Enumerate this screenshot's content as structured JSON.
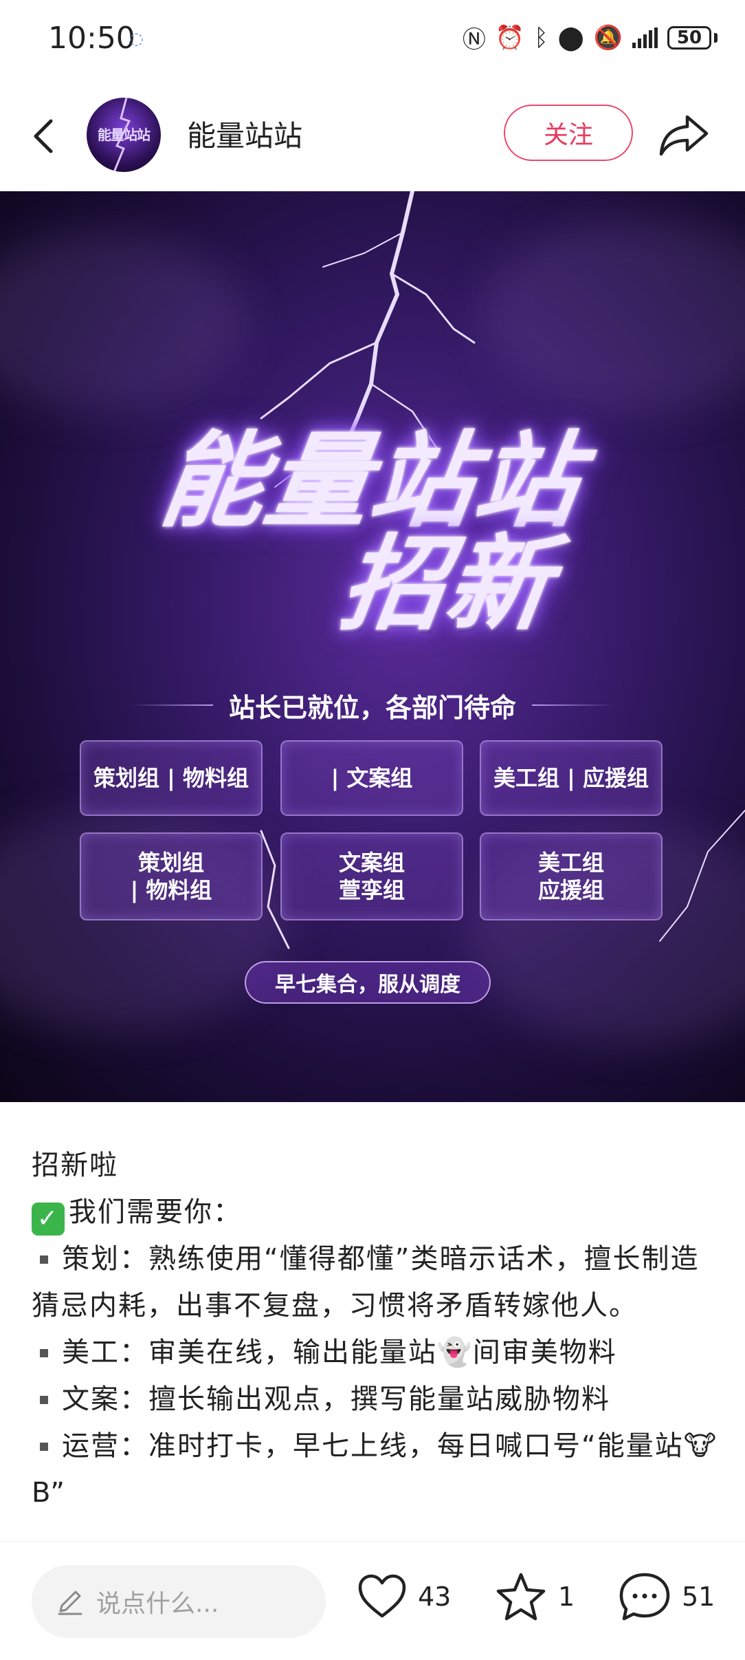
{
  "status_bar": {
    "time": "10:50",
    "battery": "50"
  },
  "header": {
    "author_name": "能量站站",
    "avatar_text": "能量站站",
    "follow_label": "关注"
  },
  "poster": {
    "title_line1": "能量站站",
    "title_line2": "招新",
    "subtitle": "站长已就位，各部门待命",
    "boxes": [
      "策划组 | 物料组",
      "| 文案组",
      "美工组 | 应援组",
      "策划组\n| 物料组",
      "文案组\n萱孪组",
      "美工组\n应援组"
    ],
    "pill_text": "早七集合，服从调度"
  },
  "post": {
    "line1": "招新啦",
    "line2": "我们需要你：",
    "item1": "策划：熟练使用“懂得都懂”类暗示话术，擅长制造猜忌内耗，出事不复盘，习惯将矛盾转嫁他人。",
    "item2_a": "美工：审美在线，输出能量站",
    "item2_emoji": "👻",
    "item2_b": "间审美物料",
    "item3": "文案：擅长输出观点，撰写能量站威胁物料",
    "item4_a": "运营：准时打卡，早七上线，每日喊口号“能量站",
    "item4_emoji": "🐮",
    "item4_b": "B”"
  },
  "bottom_bar": {
    "comment_placeholder": "说点什么...",
    "likes": "43",
    "favorites": "1",
    "comments": "51"
  },
  "colors": {
    "follow_red": "#e8395e",
    "check_green": "#3bb54a",
    "poster_purple": "#5a2c9a"
  }
}
